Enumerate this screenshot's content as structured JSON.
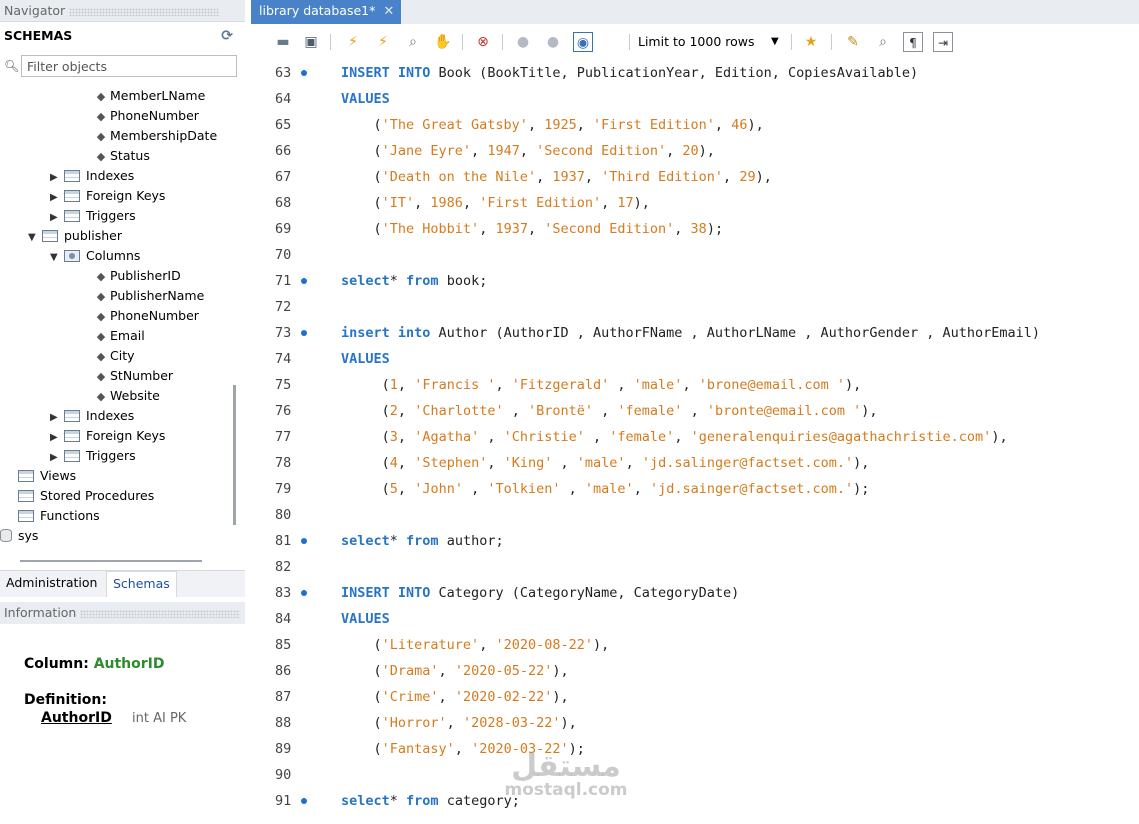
{
  "navigator": {
    "title": "Navigator",
    "schemas_label": "SCHEMAS",
    "filter_placeholder": "Filter objects",
    "tree": [
      {
        "label": "MemberLName",
        "kind": "column",
        "indent": 3
      },
      {
        "label": "PhoneNumber",
        "kind": "column",
        "indent": 3
      },
      {
        "label": "MembershipDate",
        "kind": "column",
        "indent": 3
      },
      {
        "label": "Status",
        "kind": "column",
        "indent": 3
      },
      {
        "label": "Indexes",
        "kind": "group",
        "indent": 2
      },
      {
        "label": "Foreign Keys",
        "kind": "group",
        "indent": 2
      },
      {
        "label": "Triggers",
        "kind": "group",
        "indent": 2
      },
      {
        "label": "publisher",
        "kind": "table",
        "indent": 1
      },
      {
        "label": "Columns",
        "kind": "columns",
        "indent": 2
      },
      {
        "label": "PublisherID",
        "kind": "column",
        "indent": 3
      },
      {
        "label": "PublisherName",
        "kind": "column",
        "indent": 3
      },
      {
        "label": "PhoneNumber",
        "kind": "column",
        "indent": 3
      },
      {
        "label": "Email",
        "kind": "column",
        "indent": 3
      },
      {
        "label": "City",
        "kind": "column",
        "indent": 3
      },
      {
        "label": "StNumber",
        "kind": "column",
        "indent": 3
      },
      {
        "label": "Website",
        "kind": "column",
        "indent": 3
      },
      {
        "label": "Indexes",
        "kind": "group",
        "indent": 2
      },
      {
        "label": "Foreign Keys",
        "kind": "group",
        "indent": 2
      },
      {
        "label": "Triggers",
        "kind": "group",
        "indent": 2
      },
      {
        "label": "Views",
        "kind": "folder",
        "indent": 0
      },
      {
        "label": "Stored Procedures",
        "kind": "folder",
        "indent": 0
      },
      {
        "label": "Functions",
        "kind": "folder",
        "indent": 0
      },
      {
        "label": "sys",
        "kind": "schema",
        "indent": -1
      }
    ]
  },
  "bottom_tabs": {
    "administration": "Administration",
    "schemas": "Schemas"
  },
  "information": {
    "title": "Information",
    "column_label": "Column:",
    "column_value": "AuthorID",
    "definition_label": "Definition:",
    "definition_name": "AuthorID",
    "definition_type": "int AI PK"
  },
  "editor": {
    "tab_label": "library database1*",
    "limit_label": "Limit to 1000 rows",
    "lines": [
      {
        "n": "63",
        "dot": true,
        "tokens": [
          [
            "kw",
            "INSERT INTO "
          ],
          [
            "id",
            "Book (BookTitle, PublicationYear, Edition, CopiesAvailable)"
          ]
        ]
      },
      {
        "n": "64",
        "dot": false,
        "tokens": [
          [
            "kw",
            "VALUES"
          ]
        ]
      },
      {
        "n": "65",
        "dot": false,
        "tokens": [
          [
            "id",
            "    ("
          ],
          [
            "str",
            "'The Great Gatsby'"
          ],
          [
            "id",
            ", "
          ],
          [
            "num",
            "1925"
          ],
          [
            "id",
            ", "
          ],
          [
            "str",
            "'First Edition'"
          ],
          [
            "id",
            ", "
          ],
          [
            "num",
            "46"
          ],
          [
            "id",
            "),"
          ]
        ]
      },
      {
        "n": "66",
        "dot": false,
        "tokens": [
          [
            "id",
            "    ("
          ],
          [
            "str",
            "'Jane Eyre'"
          ],
          [
            "id",
            ", "
          ],
          [
            "num",
            "1947"
          ],
          [
            "id",
            ", "
          ],
          [
            "str",
            "'Second Edition'"
          ],
          [
            "id",
            ", "
          ],
          [
            "num",
            "20"
          ],
          [
            "id",
            "),"
          ]
        ]
      },
      {
        "n": "67",
        "dot": false,
        "tokens": [
          [
            "id",
            "    ("
          ],
          [
            "str",
            "'Death on the Nile'"
          ],
          [
            "id",
            ", "
          ],
          [
            "num",
            "1937"
          ],
          [
            "id",
            ", "
          ],
          [
            "str",
            "'Third Edition'"
          ],
          [
            "id",
            ", "
          ],
          [
            "num",
            "29"
          ],
          [
            "id",
            "),"
          ]
        ]
      },
      {
        "n": "68",
        "dot": false,
        "tokens": [
          [
            "id",
            "    ("
          ],
          [
            "str",
            "'IT'"
          ],
          [
            "id",
            ", "
          ],
          [
            "num",
            "1986"
          ],
          [
            "id",
            ", "
          ],
          [
            "str",
            "'First Edition'"
          ],
          [
            "id",
            ", "
          ],
          [
            "num",
            "17"
          ],
          [
            "id",
            "),"
          ]
        ]
      },
      {
        "n": "69",
        "dot": false,
        "tokens": [
          [
            "id",
            "    ("
          ],
          [
            "str",
            "'The Hobbit'"
          ],
          [
            "id",
            ", "
          ],
          [
            "num",
            "1937"
          ],
          [
            "id",
            ", "
          ],
          [
            "str",
            "'Second Edition'"
          ],
          [
            "id",
            ", "
          ],
          [
            "num",
            "38"
          ],
          [
            "id",
            ");"
          ]
        ]
      },
      {
        "n": "70",
        "dot": false,
        "tokens": []
      },
      {
        "n": "71",
        "dot": true,
        "tokens": [
          [
            "kw",
            "select"
          ],
          [
            "id",
            "* "
          ],
          [
            "kw",
            "from"
          ],
          [
            "id",
            " book;"
          ]
        ]
      },
      {
        "n": "72",
        "dot": false,
        "tokens": []
      },
      {
        "n": "73",
        "dot": true,
        "tokens": [
          [
            "kw",
            "insert into "
          ],
          [
            "id",
            "Author (AuthorID , AuthorFName , AuthorLName , AuthorGender , AuthorEmail)"
          ]
        ]
      },
      {
        "n": "74",
        "dot": false,
        "tokens": [
          [
            "kw",
            "VALUES"
          ]
        ]
      },
      {
        "n": "75",
        "dot": false,
        "tokens": [
          [
            "id",
            "     ("
          ],
          [
            "num",
            "1"
          ],
          [
            "id",
            ", "
          ],
          [
            "str",
            "'Francis '"
          ],
          [
            "id",
            ", "
          ],
          [
            "str",
            "'Fitzgerald'"
          ],
          [
            "id",
            " , "
          ],
          [
            "str",
            "'male'"
          ],
          [
            "id",
            ", "
          ],
          [
            "str",
            "'brone@email.com '"
          ],
          [
            "id",
            "),"
          ]
        ]
      },
      {
        "n": "76",
        "dot": false,
        "tokens": [
          [
            "id",
            "     ("
          ],
          [
            "num",
            "2"
          ],
          [
            "id",
            ", "
          ],
          [
            "str",
            "'Charlotte'"
          ],
          [
            "id",
            " , "
          ],
          [
            "str",
            "'Brontë'"
          ],
          [
            "id",
            " , "
          ],
          [
            "str",
            "'female'"
          ],
          [
            "id",
            " , "
          ],
          [
            "str",
            "'bronte@email.com '"
          ],
          [
            "id",
            "),"
          ]
        ]
      },
      {
        "n": "77",
        "dot": false,
        "tokens": [
          [
            "id",
            "     ("
          ],
          [
            "num",
            "3"
          ],
          [
            "id",
            ", "
          ],
          [
            "str",
            "'Agatha'"
          ],
          [
            "id",
            " , "
          ],
          [
            "str",
            "'Christie'"
          ],
          [
            "id",
            " , "
          ],
          [
            "str",
            "'female'"
          ],
          [
            "id",
            ", "
          ],
          [
            "str",
            "'generalenquiries@agathachristie.com'"
          ],
          [
            "id",
            "),"
          ]
        ]
      },
      {
        "n": "78",
        "dot": false,
        "tokens": [
          [
            "id",
            "     ("
          ],
          [
            "num",
            "4"
          ],
          [
            "id",
            ", "
          ],
          [
            "str",
            "'Stephen'"
          ],
          [
            "id",
            ", "
          ],
          [
            "str",
            "'King'"
          ],
          [
            "id",
            " , "
          ],
          [
            "str",
            "'male'"
          ],
          [
            "id",
            ", "
          ],
          [
            "str",
            "'jd.salinger@factset.com.'"
          ],
          [
            "id",
            "),"
          ]
        ]
      },
      {
        "n": "79",
        "dot": false,
        "tokens": [
          [
            "id",
            "     ("
          ],
          [
            "num",
            "5"
          ],
          [
            "id",
            ", "
          ],
          [
            "str",
            "'John'"
          ],
          [
            "id",
            " , "
          ],
          [
            "str",
            "'Tolkien'"
          ],
          [
            "id",
            " , "
          ],
          [
            "str",
            "'male'"
          ],
          [
            "id",
            ", "
          ],
          [
            "str",
            "'jd.sainger@factset.com.'"
          ],
          [
            "id",
            ");"
          ]
        ]
      },
      {
        "n": "80",
        "dot": false,
        "tokens": []
      },
      {
        "n": "81",
        "dot": true,
        "tokens": [
          [
            "kw",
            "select"
          ],
          [
            "id",
            "* "
          ],
          [
            "kw",
            "from"
          ],
          [
            "id",
            " author;"
          ]
        ]
      },
      {
        "n": "82",
        "dot": false,
        "tokens": []
      },
      {
        "n": "83",
        "dot": true,
        "tokens": [
          [
            "kw",
            "INSERT INTO "
          ],
          [
            "id",
            "Category (CategoryName, CategoryDate)"
          ]
        ]
      },
      {
        "n": "84",
        "dot": false,
        "tokens": [
          [
            "kw",
            "VALUES"
          ]
        ]
      },
      {
        "n": "85",
        "dot": false,
        "tokens": [
          [
            "id",
            "    ("
          ],
          [
            "str",
            "'Literature'"
          ],
          [
            "id",
            ", "
          ],
          [
            "str",
            "'2020-08-22'"
          ],
          [
            "id",
            "),"
          ]
        ]
      },
      {
        "n": "86",
        "dot": false,
        "tokens": [
          [
            "id",
            "    ("
          ],
          [
            "str",
            "'Drama'"
          ],
          [
            "id",
            ", "
          ],
          [
            "str",
            "'2020-05-22'"
          ],
          [
            "id",
            "),"
          ]
        ]
      },
      {
        "n": "87",
        "dot": false,
        "tokens": [
          [
            "id",
            "    ("
          ],
          [
            "str",
            "'Crime'"
          ],
          [
            "id",
            ", "
          ],
          [
            "str",
            "'2020-02-22'"
          ],
          [
            "id",
            "),"
          ]
        ]
      },
      {
        "n": "88",
        "dot": false,
        "tokens": [
          [
            "id",
            "    ("
          ],
          [
            "str",
            "'Horror'"
          ],
          [
            "id",
            ", "
          ],
          [
            "str",
            "'2028-03-22'"
          ],
          [
            "id",
            "),"
          ]
        ]
      },
      {
        "n": "89",
        "dot": false,
        "tokens": [
          [
            "id",
            "    ("
          ],
          [
            "str",
            "'Fantasy'"
          ],
          [
            "id",
            ", "
          ],
          [
            "str",
            "'2020-03-22'"
          ],
          [
            "id",
            ");"
          ]
        ]
      },
      {
        "n": "90",
        "dot": false,
        "tokens": []
      },
      {
        "n": "91",
        "dot": true,
        "tokens": [
          [
            "kw",
            "select"
          ],
          [
            "id",
            "* "
          ],
          [
            "kw",
            "from"
          ],
          [
            "id",
            " category;"
          ]
        ]
      }
    ]
  },
  "watermark": {
    "arabic": "مستقل",
    "latin": "mostaql.com"
  },
  "colors": {
    "keyword": "#2874c5",
    "string": "#d57b1d",
    "tab": "#4a82c9",
    "column_value": "#2e8b2e"
  }
}
